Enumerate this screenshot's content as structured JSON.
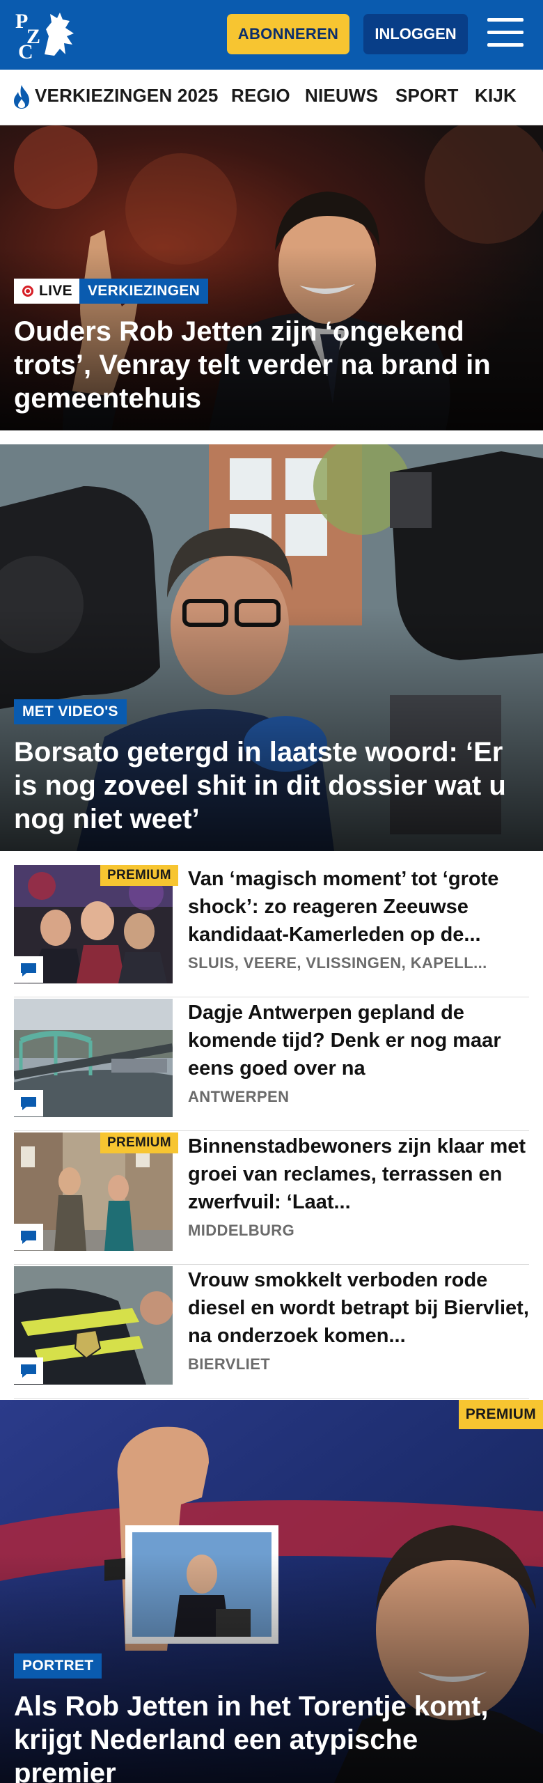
{
  "header": {
    "logo_text": "PZC",
    "subscribe_label": "ABONNEREN",
    "login_label": "INLOGGEN"
  },
  "nav": {
    "items": [
      {
        "label": "VERKIEZINGEN 2025",
        "icon": "flame-icon"
      },
      {
        "label": "REGIO"
      },
      {
        "label": "NIEUWS"
      },
      {
        "label": "SPORT"
      },
      {
        "label": "KIJK"
      }
    ]
  },
  "hero1": {
    "live_label": "LIVE",
    "category": "VERKIEZINGEN",
    "title": "Ouders Rob Jetten zijn ‘ongekend trots’, Venray telt verder na brand in gemeentehuis"
  },
  "hero2": {
    "category": "MET VIDEO'S",
    "title": "Borsato getergd in laatste woord: ‘Er is nog zoveel shit in dit dossier wat u nog niet weet’"
  },
  "list": [
    {
      "premium": "PREMIUM",
      "title": "Van ‘magisch moment’ tot ‘grote shock’: zo reageren Zeeuwse kandidaat-Kamerleden op de...",
      "location": "SLUIS, VEERE, VLISSINGEN, KAPELL..."
    },
    {
      "premium": "",
      "title": "Dagje Antwerpen gepland de komende tijd? Denk er nog maar eens goed over na",
      "location": "ANTWERPEN"
    },
    {
      "premium": "PREMIUM",
      "title": "Binnenstadbewoners zijn klaar met groei van reclames, terrassen en zwerfvuil: ‘Laat...",
      "location": "MIDDELBURG"
    },
    {
      "premium": "",
      "title": "Vrouw smokkelt verboden rode diesel en wordt betrapt bij Biervliet, na onderzoek komen...",
      "location": "BIERVLIET"
    }
  ],
  "hero3": {
    "premium": "PREMIUM",
    "category": "PORTRET",
    "title": "Als Rob Jetten in het Torentje komt, krijgt Nederland een atypische premier"
  },
  "colors": {
    "brand_blue": "#0a5baf",
    "accent_yellow": "#f7c531",
    "dark_blue": "#083e88"
  }
}
